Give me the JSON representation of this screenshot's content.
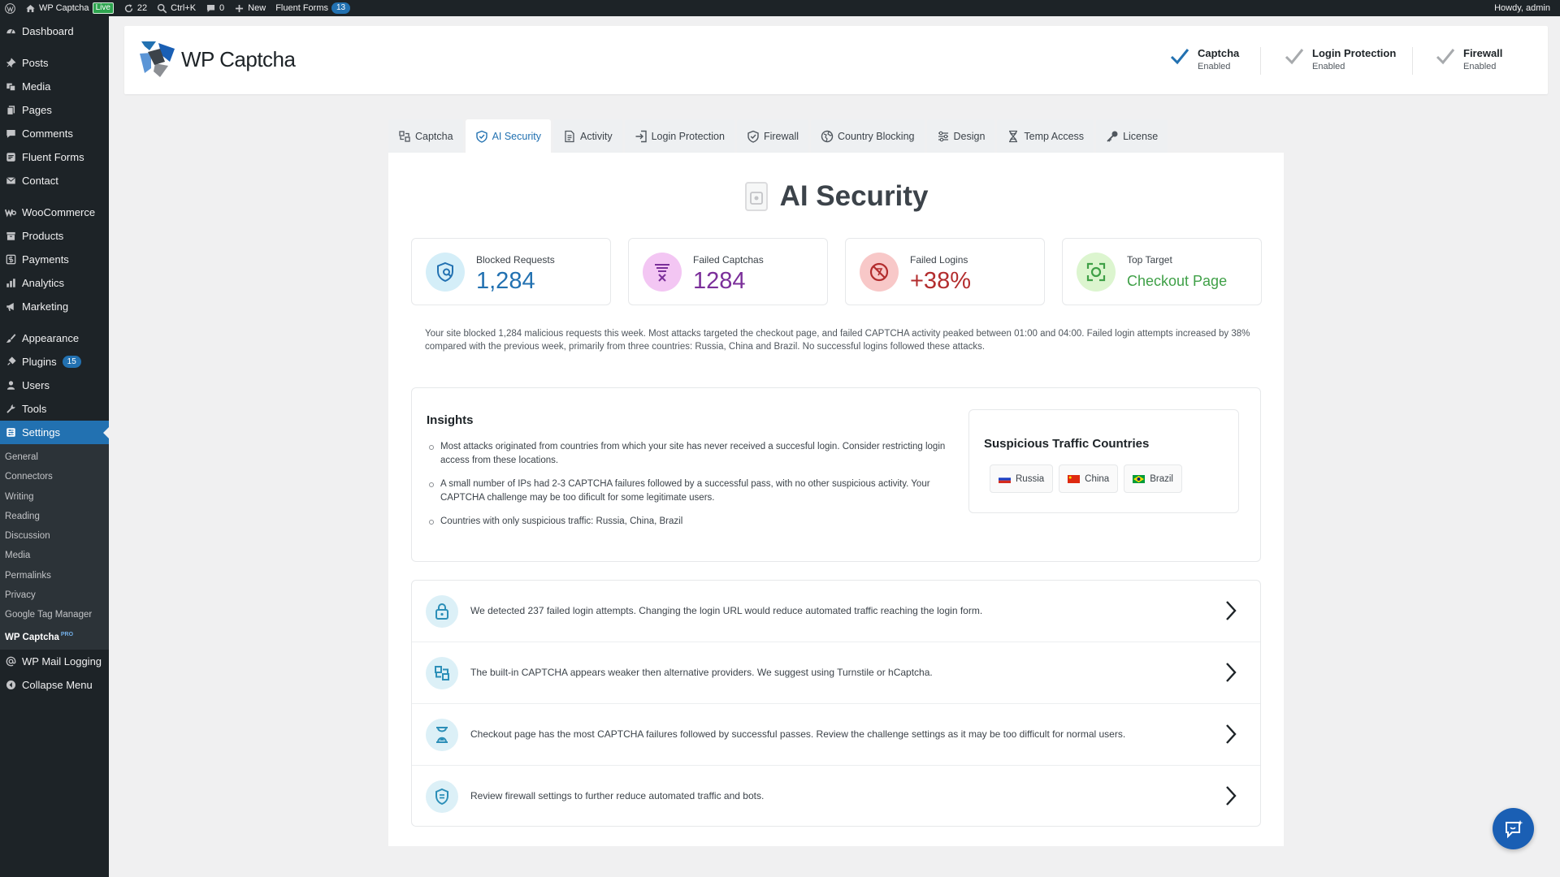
{
  "adminbar": {
    "site_name": "WP Captcha",
    "live_badge": "Live",
    "updates_count": "22",
    "search_shortcut": "Ctrl+K",
    "comments_count": "0",
    "new_label": "New",
    "fluent_forms_label": "Fluent Forms",
    "fluent_forms_count": "13",
    "howdy": "Howdy, admin"
  },
  "sidebar": {
    "items": [
      {
        "label": "Dashboard",
        "icon": "dashboard-icon"
      },
      {
        "label": "Posts",
        "icon": "pin-icon"
      },
      {
        "label": "Media",
        "icon": "media-icon"
      },
      {
        "label": "Pages",
        "icon": "pages-icon"
      },
      {
        "label": "Comments",
        "icon": "comment-icon"
      },
      {
        "label": "Fluent Forms",
        "icon": "forms-icon"
      },
      {
        "label": "Contact",
        "icon": "envelope-icon"
      },
      {
        "label": "WooCommerce",
        "icon": "woo-icon"
      },
      {
        "label": "Products",
        "icon": "archive-icon"
      },
      {
        "label": "Payments",
        "icon": "dollar-icon"
      },
      {
        "label": "Analytics",
        "icon": "bar-chart-icon"
      },
      {
        "label": "Marketing",
        "icon": "megaphone-icon"
      },
      {
        "label": "Appearance",
        "icon": "brush-icon"
      },
      {
        "label": "Plugins",
        "icon": "plug-icon",
        "badge": "15"
      },
      {
        "label": "Users",
        "icon": "user-icon"
      },
      {
        "label": "Tools",
        "icon": "wrench-icon"
      },
      {
        "label": "Settings",
        "icon": "settings-icon"
      }
    ],
    "settings_sub": [
      "General",
      "Connectors",
      "Writing",
      "Reading",
      "Discussion",
      "Media",
      "Permalinks",
      "Privacy",
      "Google Tag Manager",
      "WP Captcha"
    ],
    "pro_badge": "PRO",
    "after": [
      {
        "label": "WP Mail Logging",
        "icon": "at-icon"
      },
      {
        "label": "Collapse Menu",
        "icon": "collapse-icon"
      }
    ]
  },
  "header": {
    "logo_text": "WP Captcha",
    "statuses": [
      {
        "title": "Captcha",
        "sub": "Enabled",
        "color": "#2271b1"
      },
      {
        "title": "Login Protection",
        "sub": "Enabled",
        "color": "#a7aaad"
      },
      {
        "title": "Firewall",
        "sub": "Enabled",
        "color": "#a7aaad"
      }
    ]
  },
  "tabs": [
    "Captcha",
    "AI Security",
    "Activity",
    "Login Protection",
    "Firewall",
    "Country Blocking",
    "Design",
    "Temp Access",
    "License"
  ],
  "active_tab": "AI Security",
  "page_title": "AI Security",
  "stats": [
    {
      "label": "Blocked Requests",
      "value": "1,284",
      "color": "#2271b1",
      "bg": "#d4eef8",
      "icon": "shield-search-icon"
    },
    {
      "label": "Failed Captchas",
      "value": "1284",
      "color": "#7b2f9a",
      "bg": "#f3c6f3",
      "icon": "filter-x-icon"
    },
    {
      "label": "Failed Logins",
      "value": "+38%",
      "color": "#b32d2e",
      "bg": "#f8c8c8",
      "icon": "blocked-icon"
    },
    {
      "label": "Top Target",
      "value": "Checkout Page",
      "color": "#3fa047",
      "bg": "#dcf5cf",
      "icon": "target-focus-icon"
    }
  ],
  "summary": "Your site blocked 1,284 malicious requests this week. Most attacks targeted the checkout page, and failed CAPTCHA activity peaked between 01:00 and 04:00. Failed login attempts increased by 38% compared with the previous week, primarily from three countries: Russia, China and Brazil. No successful logins followed these attacks.",
  "insights": {
    "heading": "Insights",
    "items": [
      "Most attacks originated from countries from which your site has never received a succesful login. Consider restricting login access from these locations.",
      "A small number of IPs had 2-3 CAPTCHA failures followed by a successful pass, with no other suspicious activity. Your CAPTCHA challenge may be too dificult for some legitimate users.",
      "Countries with only suspicious traffic: Russia, China, Brazil"
    ]
  },
  "suspicious": {
    "heading": "Suspicious Traffic Countries",
    "countries": [
      "Russia",
      "China",
      "Brazil"
    ]
  },
  "actions": [
    {
      "text": "We detected 237 failed login attempts. Changing the login URL would reduce automated traffic reaching the login form.",
      "icon": "lock-icon"
    },
    {
      "text": "The built-in CAPTCHA appears weaker then alternative providers. We suggest using Turnstile or hCaptcha.",
      "icon": "puzzle-icon"
    },
    {
      "text": "Checkout page has the most CAPTCHA failures followed by successful passes. Review the challenge settings as it may be too difficult for normal users.",
      "icon": "hourglass-icon"
    },
    {
      "text": "Review firewall settings to further reduce automated traffic and bots.",
      "icon": "shield-icon"
    }
  ]
}
